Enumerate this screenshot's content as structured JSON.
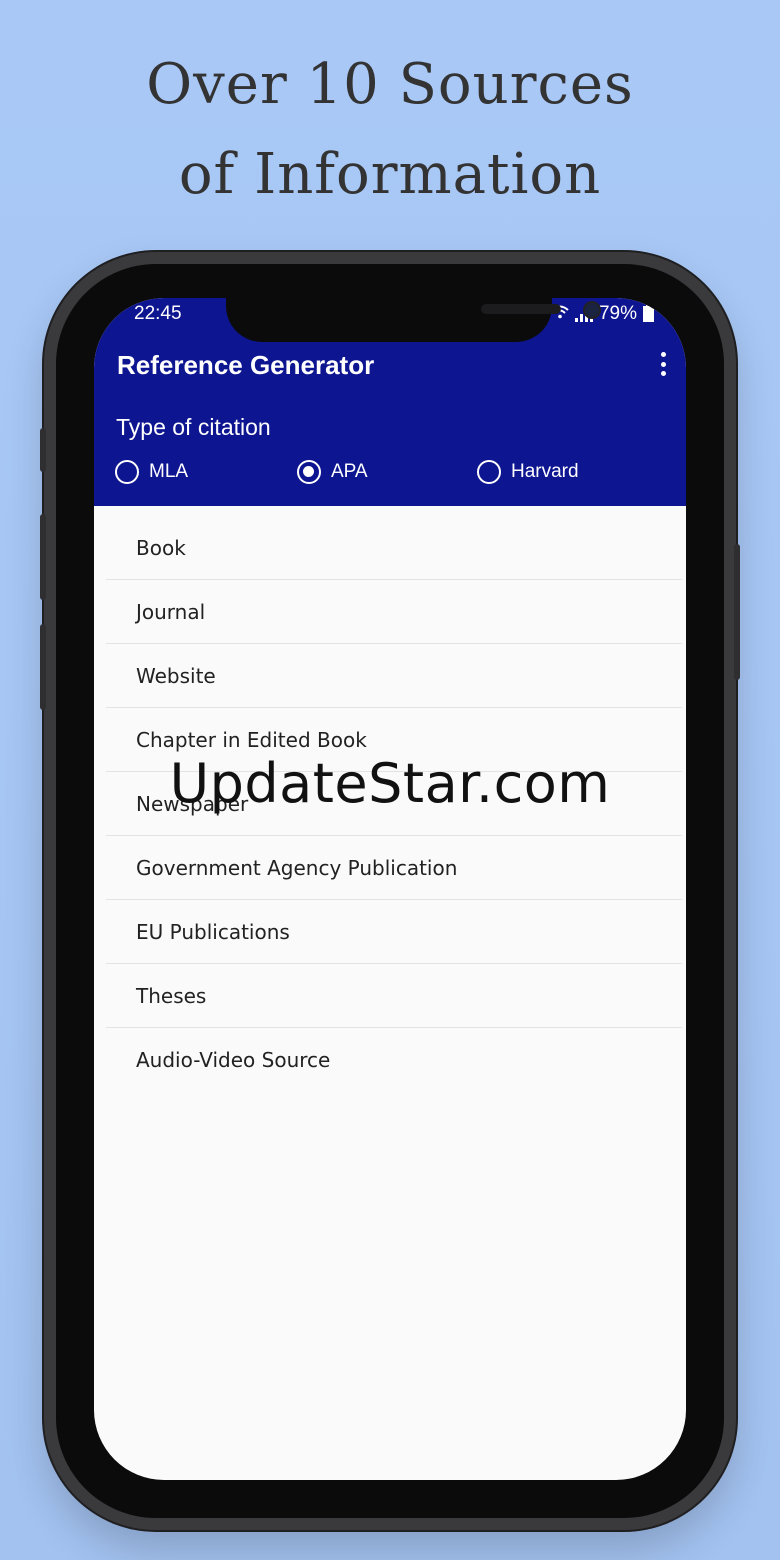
{
  "headline": {
    "line1": "Over 10 Sources",
    "line2": "of Information"
  },
  "status_bar": {
    "time": "22:45",
    "battery": "79%",
    "icons": [
      "wifi-icon",
      "signal-icon",
      "battery-icon"
    ]
  },
  "app_bar": {
    "title": "Reference Generator",
    "menu_icon": "more-vert-icon",
    "background": "#0d1590"
  },
  "citation_type": {
    "label": "Type of citation",
    "options": [
      {
        "label": "MLA",
        "selected": false
      },
      {
        "label": "APA",
        "selected": true
      },
      {
        "label": "Harvard",
        "selected": false
      }
    ]
  },
  "sources": [
    "Book",
    "Journal",
    "Website",
    "Chapter in Edited Book",
    "Newspaper",
    "Government Agency Publication",
    "EU Publications",
    "Theses",
    "Audio-Video Source"
  ],
  "watermark": "UpdateStar.com",
  "colors": {
    "background": "#a9c8f6",
    "accent": "#0d1590",
    "phone_frame": "#3a3a3c"
  }
}
